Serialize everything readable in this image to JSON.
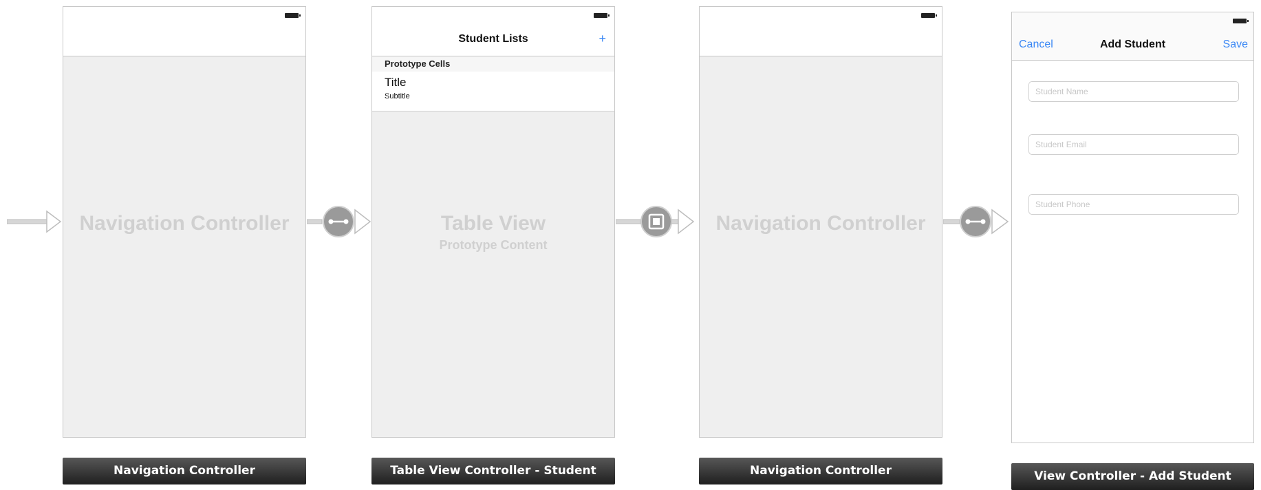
{
  "scenes": [
    {
      "placeholder_title": "Navigation Controller",
      "label": "Navigation Controller"
    },
    {
      "nav_title": "Student Lists",
      "add_button": "+",
      "prototype_header": "Prototype Cells",
      "cell_title": "Title",
      "cell_subtitle": "Subtitle",
      "placeholder_title": "Table View",
      "placeholder_subtitle": "Prototype Content",
      "label": "Table View Controller - Student"
    },
    {
      "placeholder_title": "Navigation Controller",
      "label": "Navigation Controller"
    },
    {
      "cancel_button": "Cancel",
      "nav_title": "Add Student",
      "save_button": "Save",
      "fields": [
        {
          "placeholder": "Student Name"
        },
        {
          "placeholder": "Student Email"
        },
        {
          "placeholder": "Student Phone"
        }
      ],
      "label": "View Controller - Add Student"
    }
  ],
  "segue_icons": [
    "relationship-segue-icon",
    "modal-segue-icon",
    "relationship-segue-icon"
  ],
  "colors": {
    "accent": "#3a87f5",
    "canvas_bg": "#efefef",
    "placeholder_text": "#d0d0d0",
    "label_bar": "#2e2e2e"
  }
}
